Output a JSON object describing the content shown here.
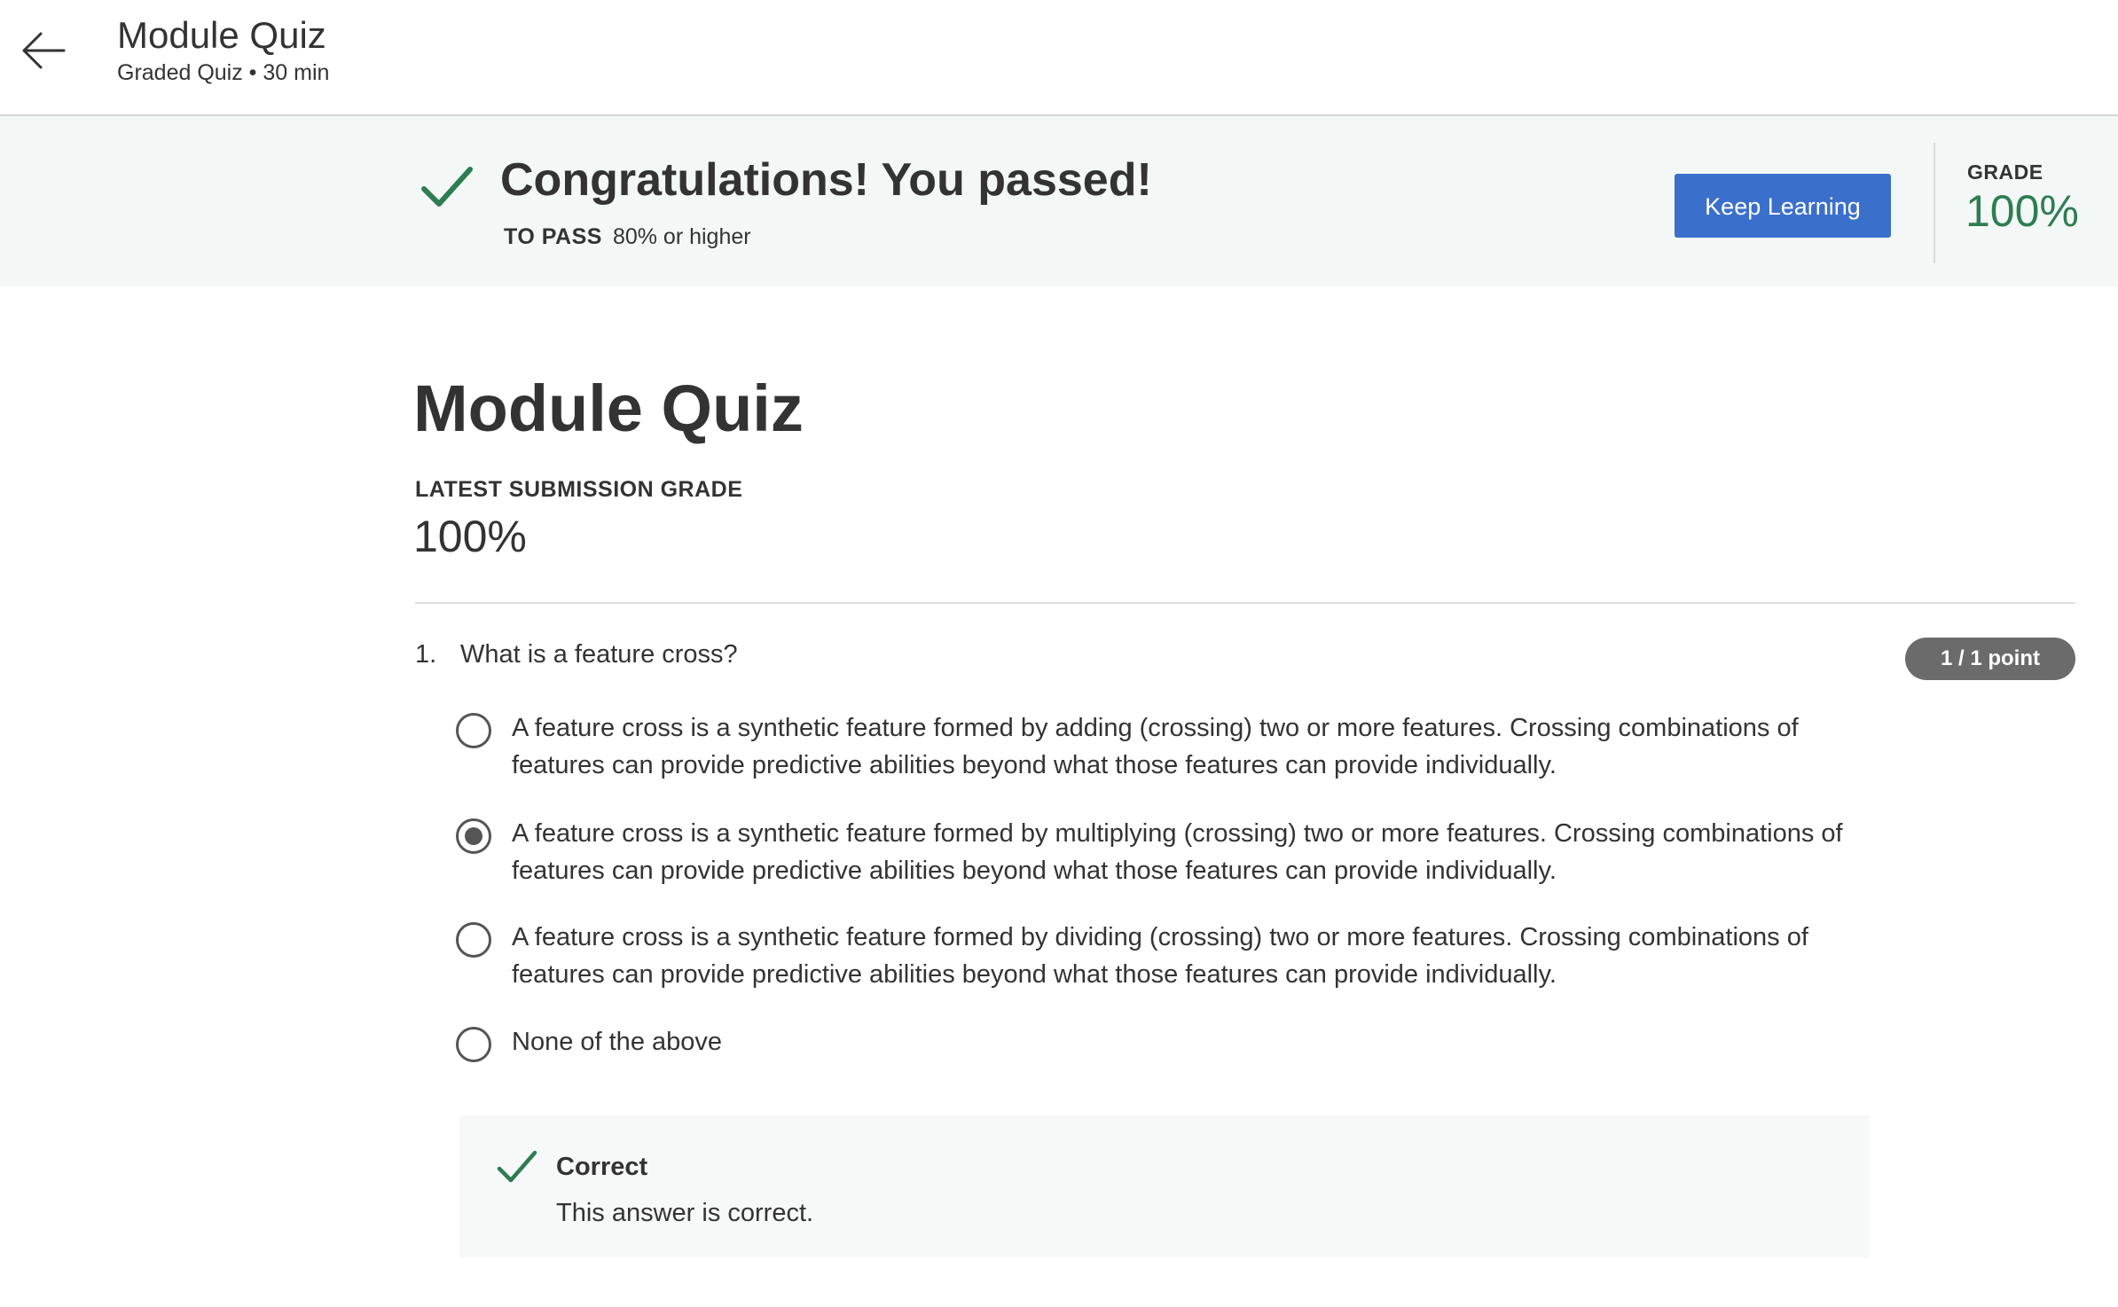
{
  "header": {
    "title": "Module Quiz",
    "subtitle": "Graded Quiz • 30 min",
    "back_icon": "arrow-left-icon"
  },
  "banner": {
    "heading": "Congratulations! You passed!",
    "to_pass_label": "TO PASS",
    "to_pass_value": "80% or higher",
    "keep_learning_label": "Keep Learning",
    "grade_label": "GRADE",
    "grade_value": "100%",
    "accent_color": "#2e7d52",
    "button_color": "#3b6fcc"
  },
  "main": {
    "title": "Module Quiz",
    "latest_grade_label": "LATEST SUBMISSION GRADE",
    "latest_grade_value": "100%"
  },
  "question": {
    "number": "1.",
    "text": "What is a feature cross?",
    "points": "1 / 1 point",
    "options": [
      {
        "text": "A feature cross is a synthetic feature formed by adding (crossing) two or more features. Crossing combinations of features can provide predictive abilities beyond what those features can provide individually.",
        "selected": false
      },
      {
        "text": "A feature cross is a synthetic feature formed by multiplying (crossing) two or more features. Crossing combinations of features can provide predictive abilities beyond what those features can provide individually.",
        "selected": true
      },
      {
        "text": "A feature cross is a synthetic feature formed by dividing (crossing) two or more features. Crossing combinations of features can provide predictive abilities beyond what those features can provide individually.",
        "selected": false
      },
      {
        "text": "None of the above",
        "selected": false
      }
    ],
    "feedback": {
      "title": "Correct",
      "text": "This answer is correct.",
      "icon": "check-icon"
    }
  }
}
